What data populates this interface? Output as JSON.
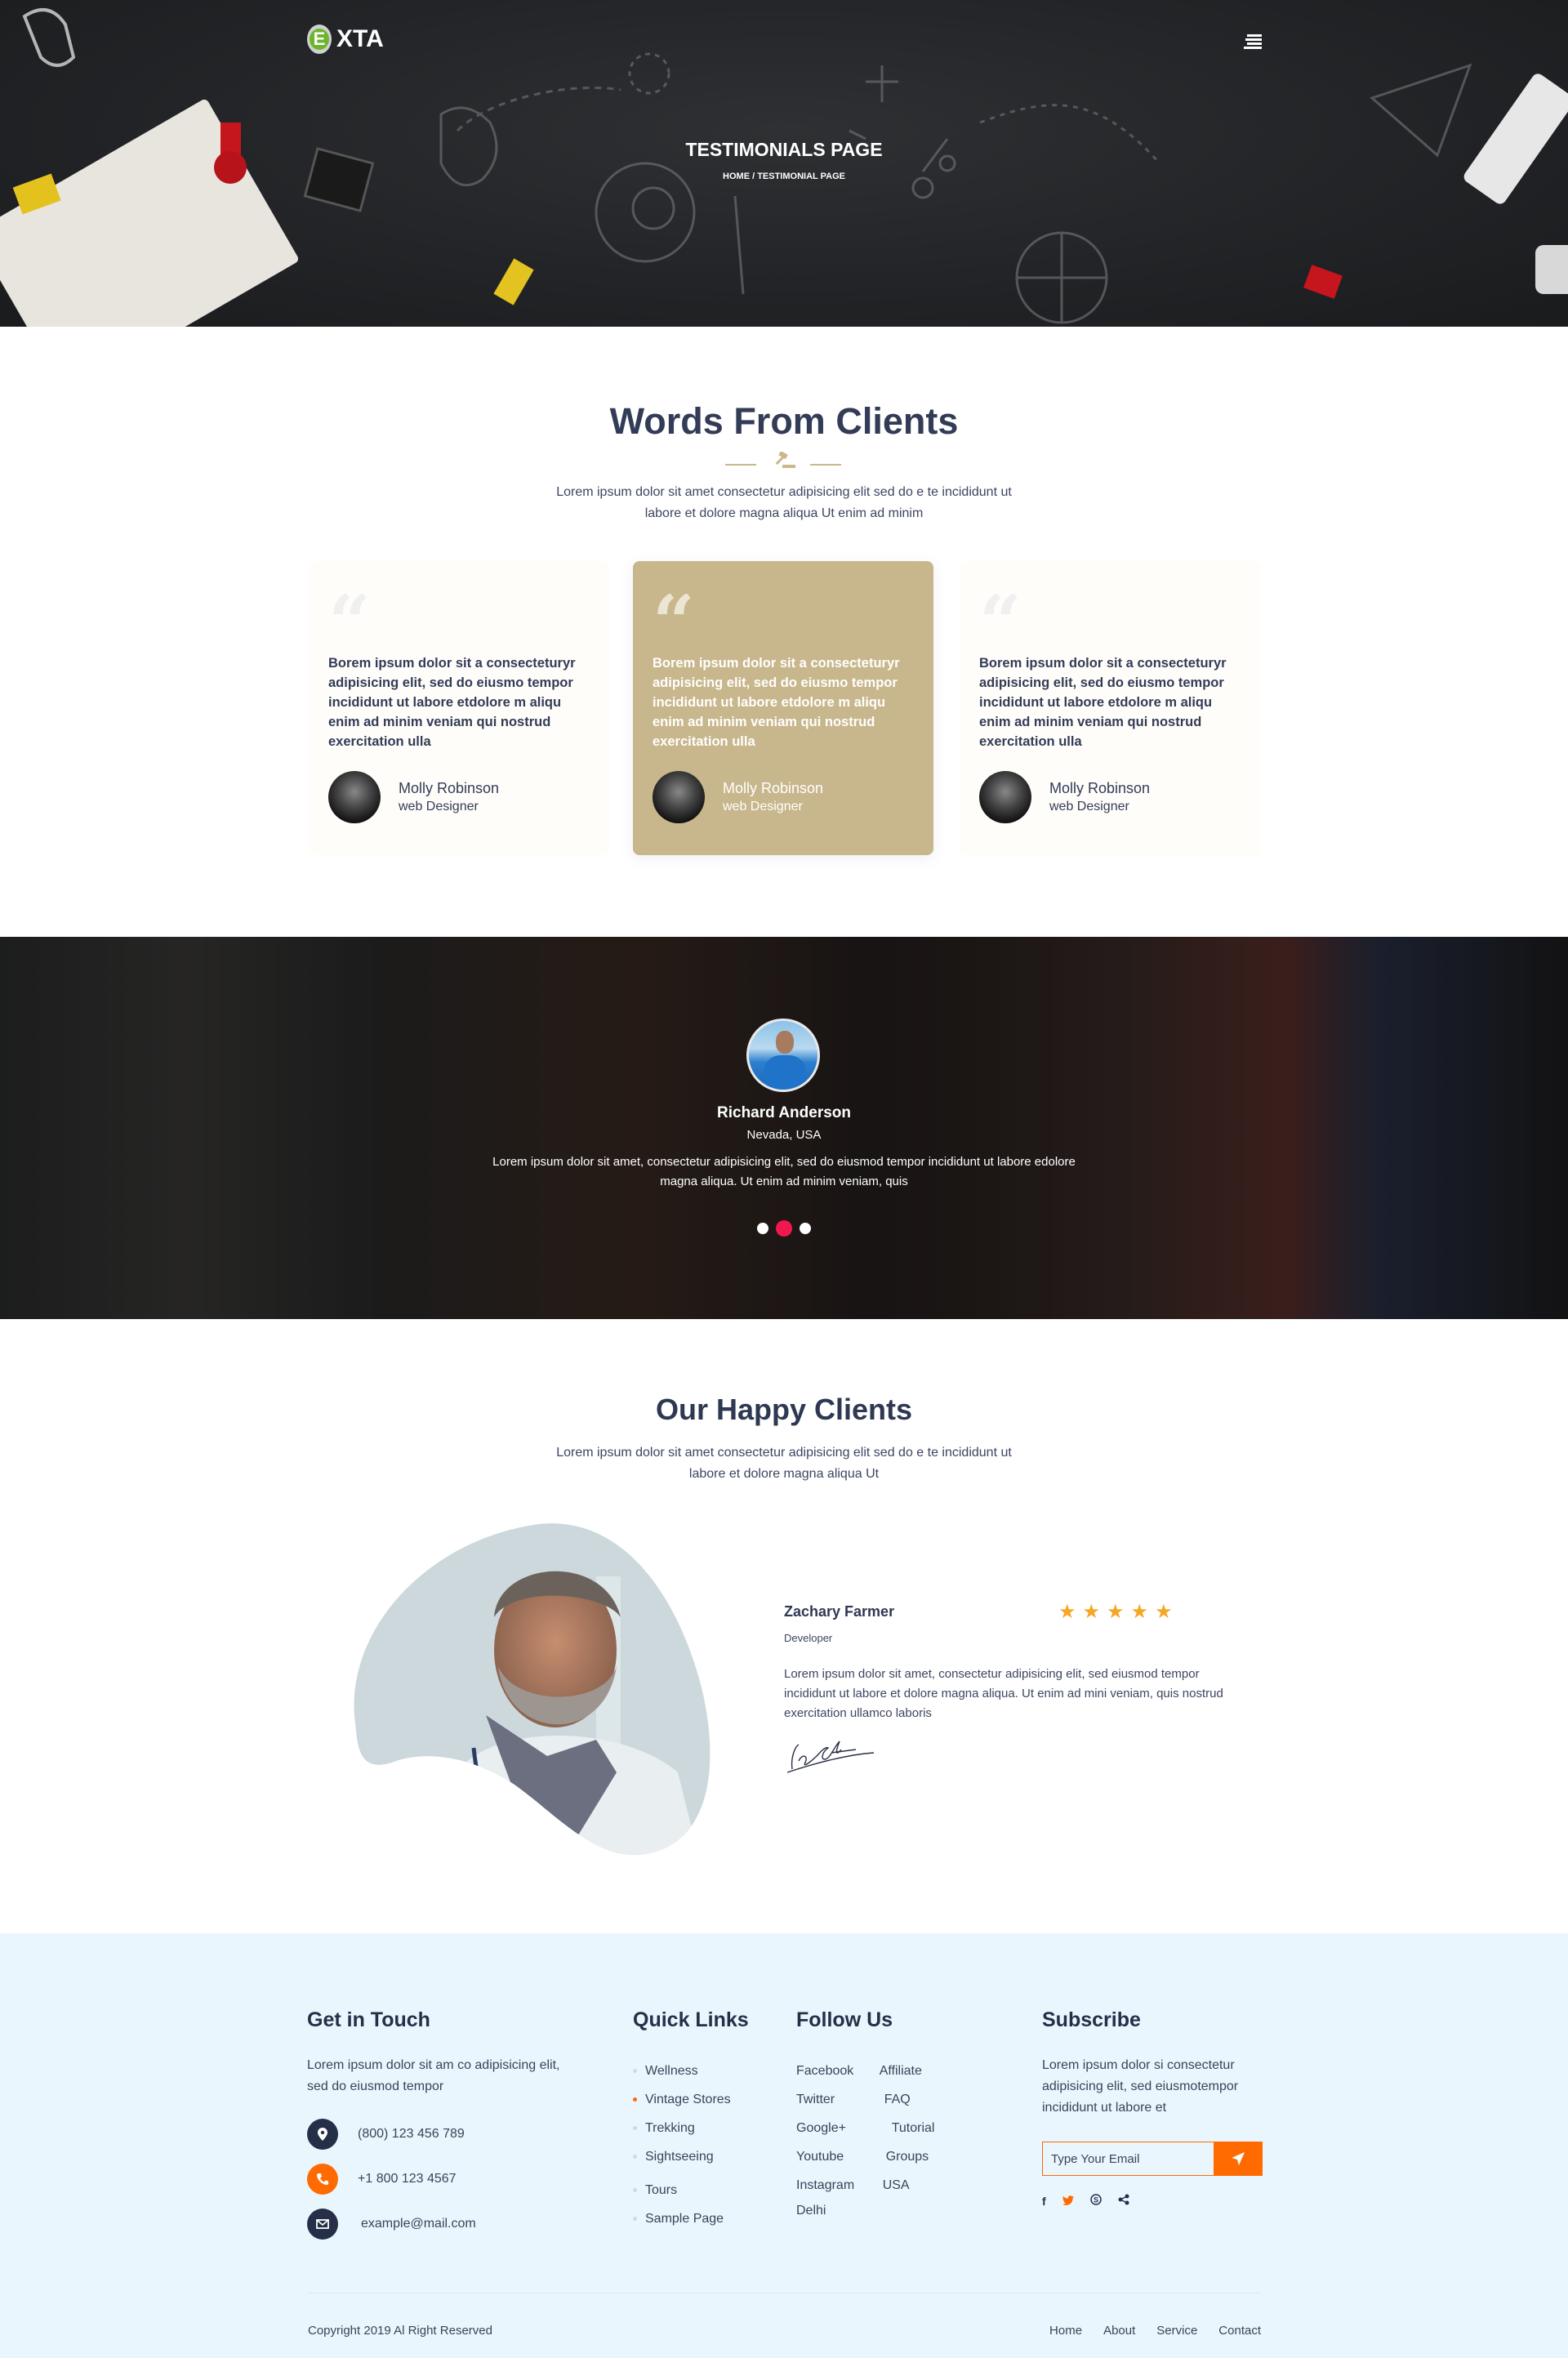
{
  "header": {
    "logo_badge": "E",
    "logo_text": "XTA",
    "page_title": "TESTIMONIALS PAGE",
    "breadcrumb": "HOME / TESTIMONIAL PAGE"
  },
  "words": {
    "title": "Words From Clients",
    "subtitle": "Lorem ipsum dolor sit amet consectetur adipisicing elit sed do e te incididunt ut labore et dolore magna aliqua Ut enim ad minim",
    "cards": [
      {
        "text": "Borem ipsum dolor sit a consecteturyr adipisicing elit, sed do eiusmo tempor incididunt ut labore etdolore m aliqu enim ad minim veniam qui nostrud exercitation ulla",
        "name": "Molly Robinson",
        "role": "web Designer",
        "active": false
      },
      {
        "text": "Borem ipsum dolor sit a consecteturyr adipisicing elit, sed do eiusmo tempor incididunt ut labore etdolore m aliqu enim ad minim veniam qui nostrud exercitation ulla",
        "name": "Molly Robinson",
        "role": "web Designer",
        "active": true
      },
      {
        "text": "Borem ipsum dolor sit a consecteturyr adipisicing elit, sed do eiusmo tempor incididunt ut labore etdolore m aliqu enim ad minim veniam qui nostrud exercitation ulla",
        "name": "Molly Robinson",
        "role": "web Designer",
        "active": false
      }
    ],
    "quote_glyph": "“"
  },
  "banner": {
    "name": "Richard Anderson",
    "location": "Nevada, USA",
    "text": "Lorem ipsum dolor sit amet, consectetur adipisicing elit, sed do eiusmod tempor incididunt ut labore edolore magna aliqua. Ut enim ad minim veniam, quis",
    "slides": 3,
    "active_slide": 2
  },
  "happy": {
    "title": "Our Happy Clients",
    "subtitle": "Lorem ipsum dolor sit amet consectetur adipisicing elit sed do e te incididunt ut labore et dolore magna aliqua Ut",
    "name": "Zachary Farmer",
    "role": "Developer",
    "rating": 5,
    "rating_max": 5,
    "star_glyph": "★",
    "text": "Lorem ipsum dolor sit amet, consectetur adipisicing elit, sed  eiusmod tempor incididunt ut labore et dolore magna aliqua. Ut enim ad mini veniam, quis nostrud exercitation ullamco laboris"
  },
  "footer": {
    "touch": {
      "title": "Get in Touch",
      "text": "Lorem ipsum dolor sit am co adipisicing elit, sed do eiusmod tempor",
      "address": "(800) 123 456 789",
      "phone": "+1 800 123 4567",
      "email": "example@mail.com"
    },
    "quick_links": {
      "title": "Quick Links",
      "items": [
        "Wellness",
        "Vintage Stores",
        "Trekking",
        "Sightseeing",
        "Tours",
        "Sample Page"
      ],
      "highlighted": 1
    },
    "follow": {
      "title": "Follow Us",
      "items": [
        "Facebook",
        "Affiliate",
        "Twitter",
        "FAQ",
        "Google+",
        "Tutorial",
        "Youtube",
        "Groups",
        "Instagram",
        "USA",
        "Delhi"
      ]
    },
    "subscribe": {
      "title": "Subscribe",
      "text": "Lorem ipsum dolor si  consectetur adipisicing elit, sed eiusmotempor incididunt ut labore et",
      "placeholder": "Type Your Email",
      "socials": [
        "facebook-icon",
        "twitter-icon",
        "skype-icon",
        "share-icon"
      ]
    },
    "copyright": "Copyright 2019 Al Right Reserved",
    "nav": [
      "Home",
      "About",
      "Service",
      "Contact"
    ]
  },
  "colors": {
    "accent_gold": "#c8b78c",
    "accent_orange": "#ff6b00",
    "dot_active": "#f2184f",
    "star": "#f6a623",
    "navy": "#2f3852",
    "footer_bg": "#eaf6fe",
    "logo_green": "#6cb52d"
  }
}
